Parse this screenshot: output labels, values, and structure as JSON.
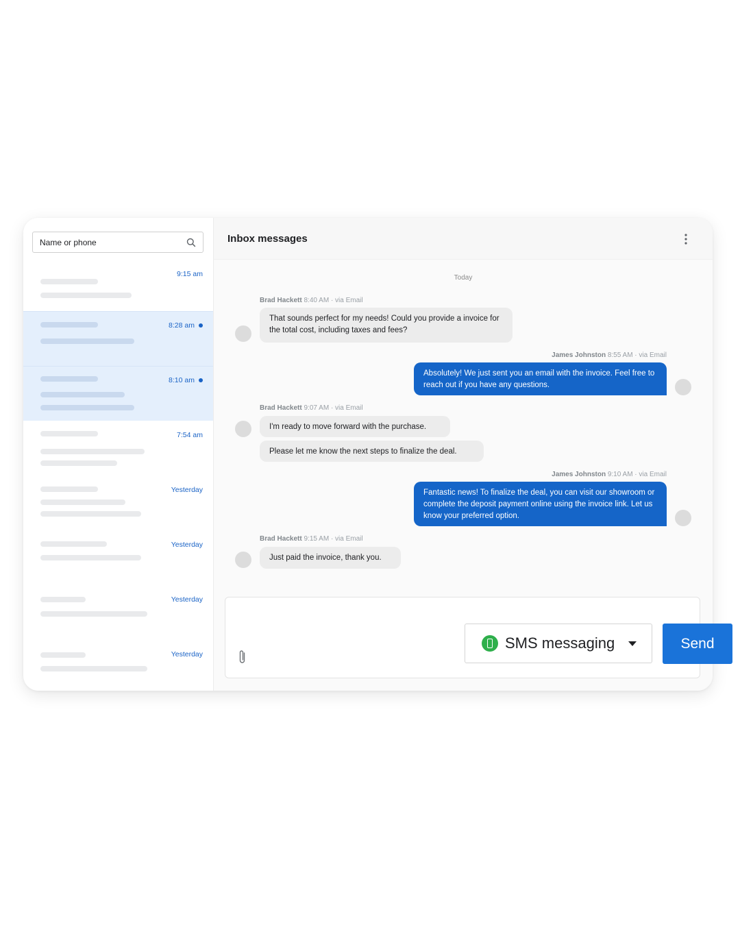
{
  "search": {
    "placeholder": "Name or phone"
  },
  "conversations": [
    {
      "time": "9:15 am"
    },
    {
      "time": "8:28 am"
    },
    {
      "time": "8:10 am"
    },
    {
      "time": "7:54 am"
    },
    {
      "time": "Yesterday"
    },
    {
      "time": "Yesterday"
    },
    {
      "time": "Yesterday"
    },
    {
      "time": "Yesterday"
    }
  ],
  "header": {
    "title": "Inbox messages"
  },
  "thread": {
    "day_label": "Today",
    "messages": [
      {
        "sender": "Brad Hackett",
        "meta": "8:40 AM · via Email",
        "text": "That sounds perfect for my needs! Could you provide a invoice for the total cost, including taxes and fees?"
      },
      {
        "sender": "James Johnston",
        "meta": "8:55 AM · via Email",
        "text": "Absolutely! We just sent you an email with the invoice. Feel free to reach out if you have any questions."
      },
      {
        "sender": "Brad Hackett",
        "meta": "9:07 AM · via Email",
        "text": "I'm ready to move forward with the purchase."
      },
      {
        "text": "Please let me know the next steps to finalize the deal."
      },
      {
        "sender": "James Johnston",
        "meta": "9:10 AM · via Email",
        "text": "Fantastic news! To finalize the deal, you can visit our showroom or complete the deposit payment online using the invoice link. Let us know your preferred option."
      },
      {
        "sender": "Brad Hackett",
        "meta": "9:15 AM · via Email",
        "text": "Just paid the invoice, thank you."
      }
    ]
  },
  "composer": {
    "channel": "SMS messaging",
    "send_label": "Send"
  },
  "colors": {
    "accent": "#1565c8",
    "active_row": "#e4effc",
    "sms_green": "#2eaf4b"
  }
}
